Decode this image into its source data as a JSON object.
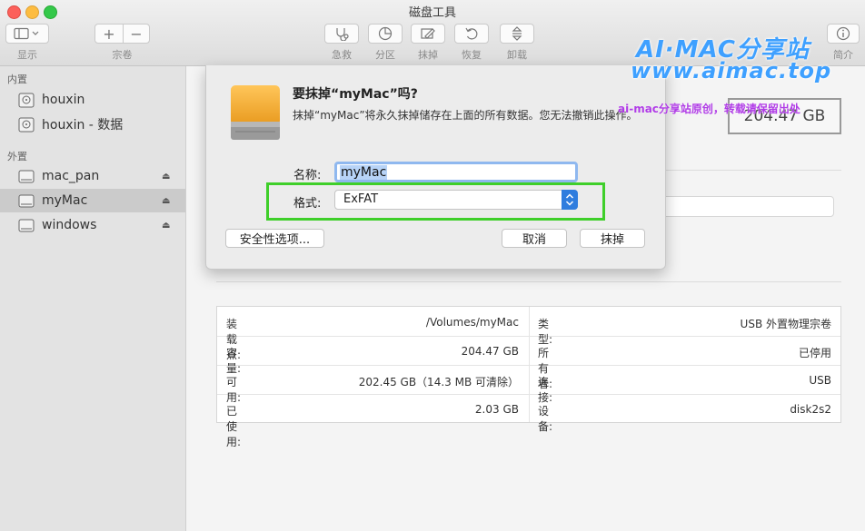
{
  "window": {
    "title": "磁盘工具"
  },
  "toolbar": {
    "view_label": "显示",
    "volume_label": "宗卷",
    "firstaid_label": "急救",
    "partition_label": "分区",
    "erase_label": "抹掉",
    "restore_label": "恢复",
    "unmount_label": "卸载",
    "info_label": "简介",
    "add_glyph": "+",
    "remove_glyph": "−"
  },
  "sidebar": {
    "internal_header": "内置",
    "external_header": "外置",
    "internal": [
      {
        "name": "houxin"
      },
      {
        "name": "houxin - 数据"
      }
    ],
    "external": [
      {
        "name": "mac_pan",
        "eject": "⏏"
      },
      {
        "name": "myMac",
        "eject": "⏏",
        "selected": true
      },
      {
        "name": "windows",
        "eject": "⏏"
      }
    ]
  },
  "dialog": {
    "title": "要抹掉“myMac”吗?",
    "message": "抹掉“myMac”将永久抹掉储存在上面的所有数据。您无法撤销此操作。",
    "name_label": "名称:",
    "name_value": "myMac",
    "format_label": "格式:",
    "format_value": "ExFAT",
    "security_button": "安全性选项...",
    "cancel_button": "取消",
    "erase_button": "抹掉"
  },
  "capacity_badge": "204.47 GB",
  "info": {
    "left": [
      {
        "label": "装载点:",
        "value": "/Volumes/myMac"
      },
      {
        "label": "容量:",
        "value": "204.47 GB"
      },
      {
        "label": "可用:",
        "value": "202.45 GB（14.3 MB 可清除）"
      },
      {
        "label": "已使用:",
        "value": "2.03 GB"
      }
    ],
    "right": [
      {
        "label": "类型:",
        "value": "USB 外置物理宗卷"
      },
      {
        "label": "所有者:",
        "value": "已停用"
      },
      {
        "label": "连接:",
        "value": "USB"
      },
      {
        "label": "设备:",
        "value": "disk2s2"
      }
    ]
  },
  "watermark": {
    "line1": "AI·MAC分享站",
    "line2": "www.aimac.top",
    "line3": "ai-mac分享站原创，转载请保留出处"
  },
  "colors": {
    "highlight_green": "#3fcf2a",
    "accent_blue": "#2f7dde",
    "watermark_blue": "#3ea0ff"
  }
}
